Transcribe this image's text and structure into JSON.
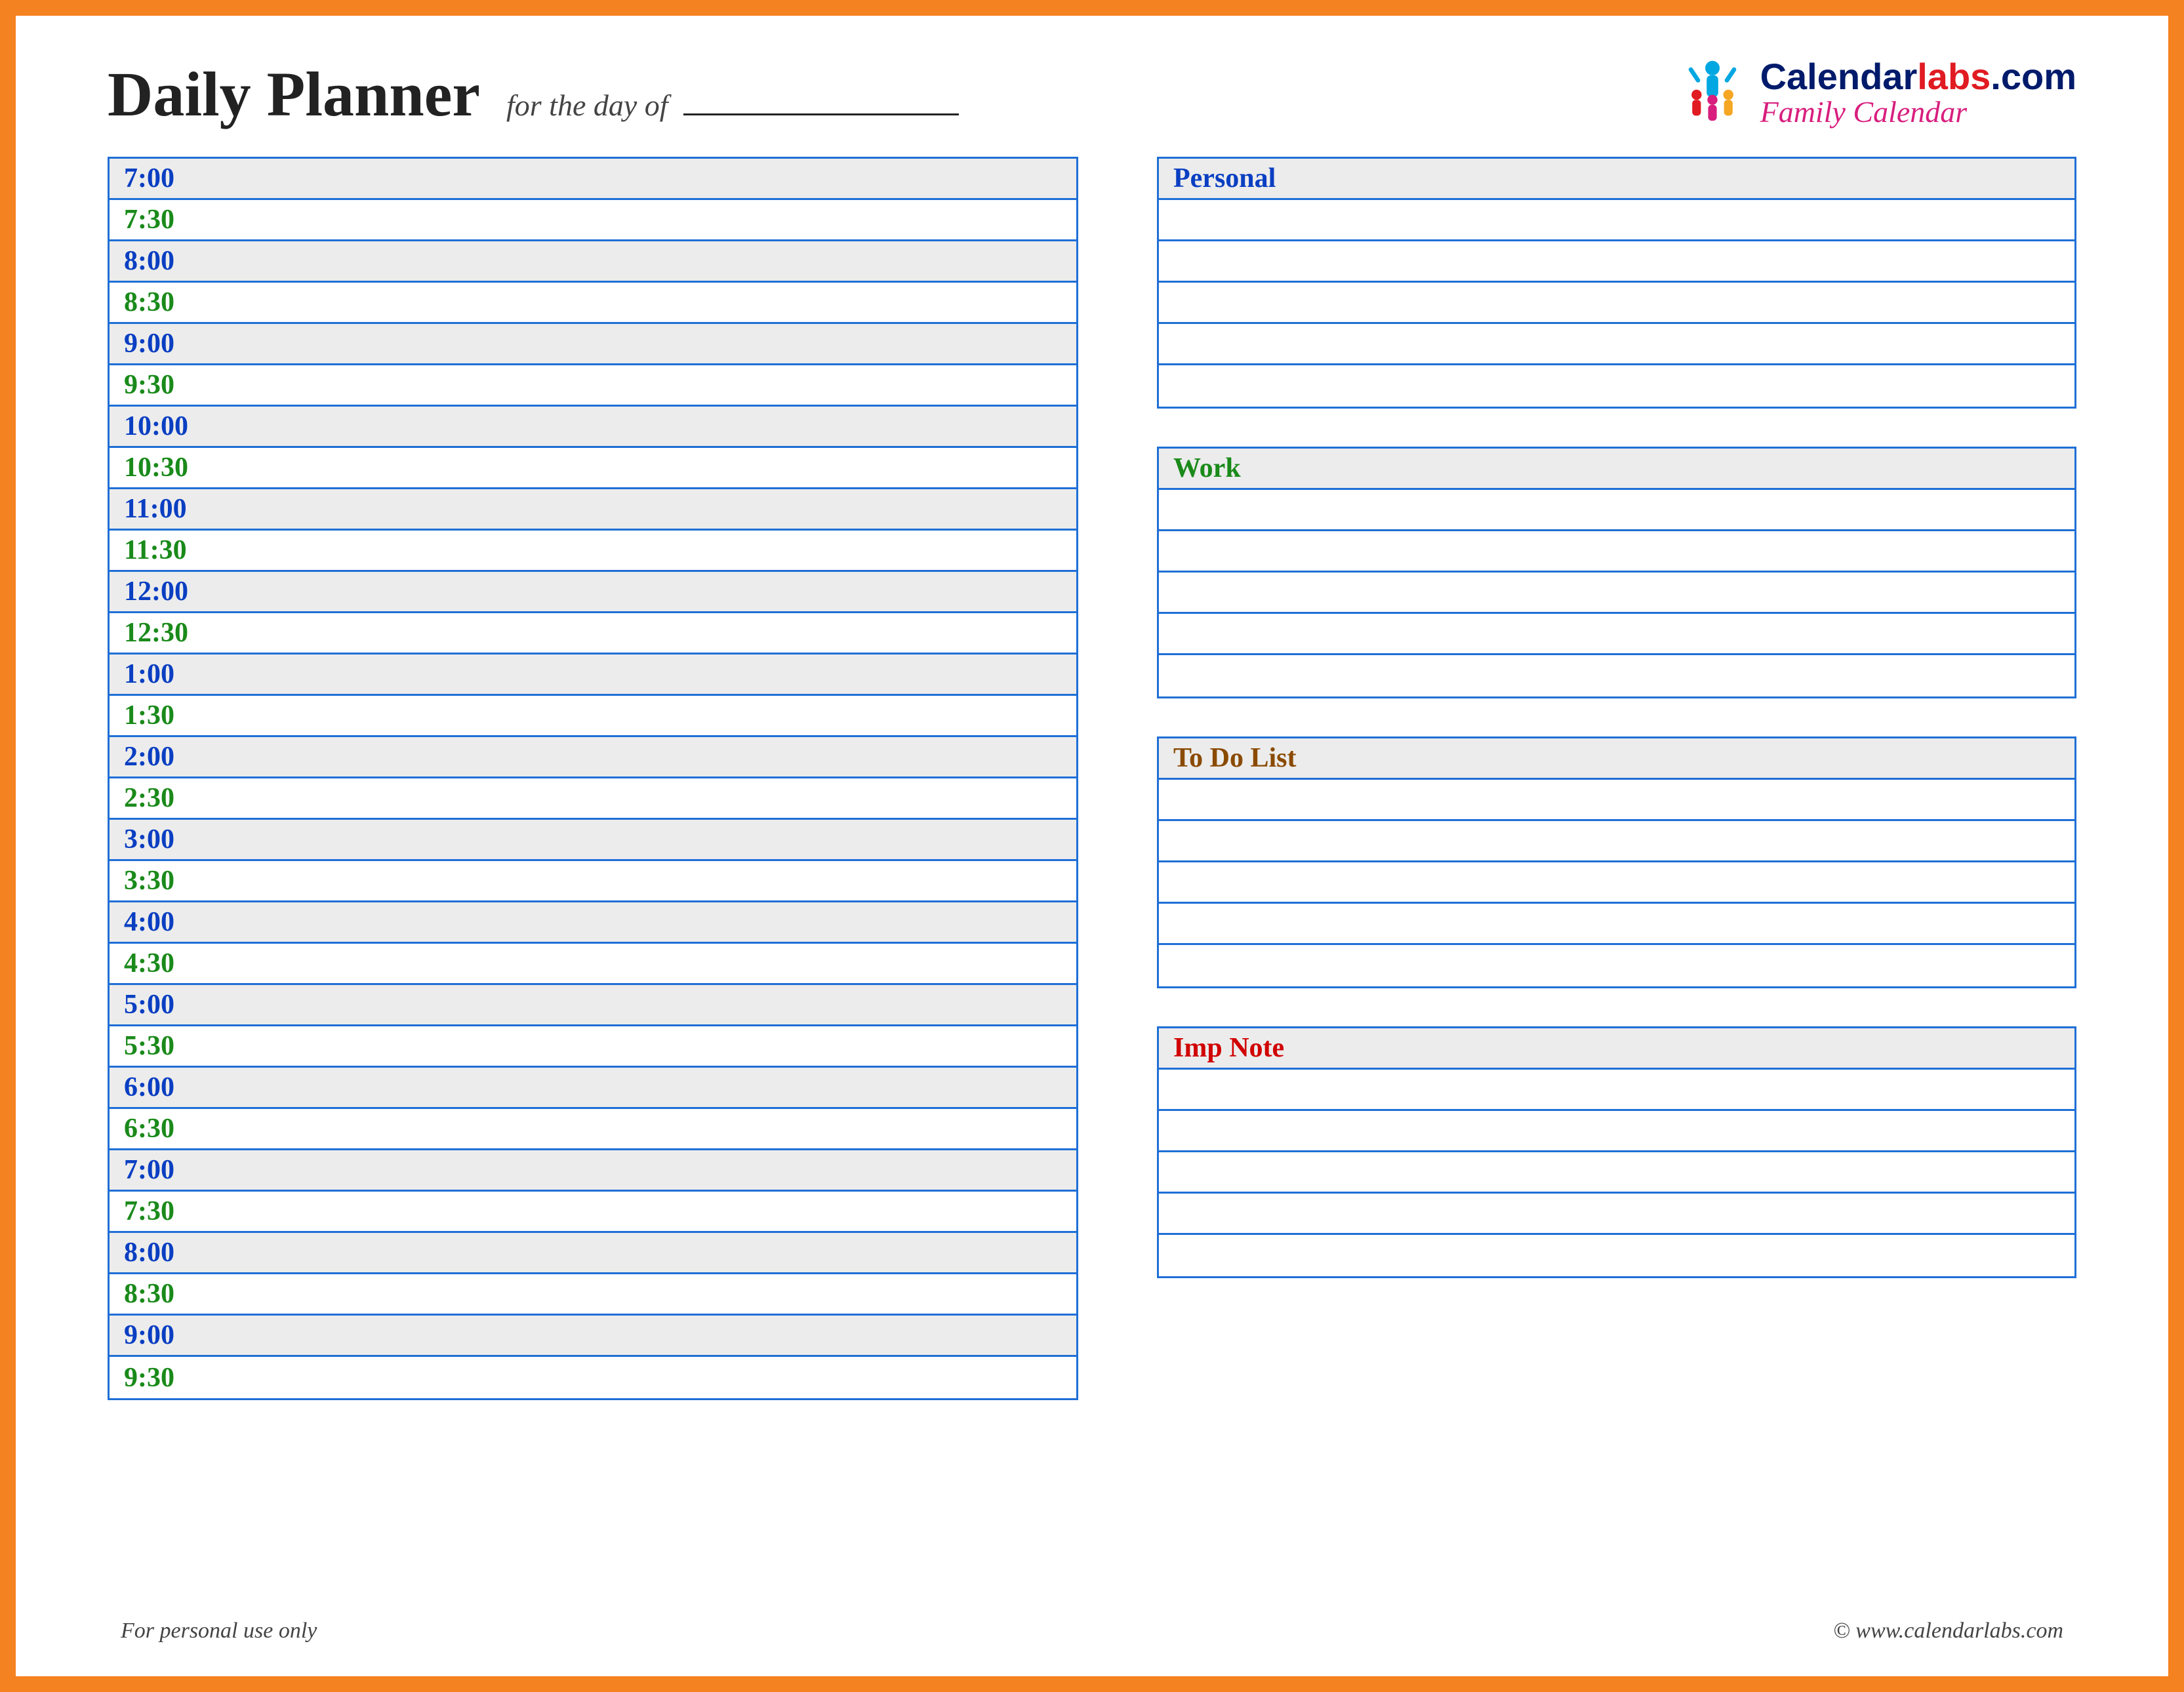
{
  "title": "Daily Planner",
  "subtitle": "for the day of",
  "logo": {
    "top_a": "Calendar",
    "top_b": "labs",
    "top_c": ".com",
    "bottom": "Family Calendar"
  },
  "times": [
    {
      "label": "7:00",
      "clr": "blue"
    },
    {
      "label": "7:30",
      "clr": "green"
    },
    {
      "label": "8:00",
      "clr": "blue"
    },
    {
      "label": "8:30",
      "clr": "green"
    },
    {
      "label": "9:00",
      "clr": "blue"
    },
    {
      "label": "9:30",
      "clr": "green"
    },
    {
      "label": "10:00",
      "clr": "blue"
    },
    {
      "label": "10:30",
      "clr": "green"
    },
    {
      "label": "11:00",
      "clr": "blue"
    },
    {
      "label": "11:30",
      "clr": "green"
    },
    {
      "label": "12:00",
      "clr": "blue"
    },
    {
      "label": "12:30",
      "clr": "green"
    },
    {
      "label": "1:00",
      "clr": "blue"
    },
    {
      "label": "1:30",
      "clr": "green"
    },
    {
      "label": "2:00",
      "clr": "blue"
    },
    {
      "label": "2:30",
      "clr": "green"
    },
    {
      "label": "3:00",
      "clr": "blue"
    },
    {
      "label": "3:30",
      "clr": "green"
    },
    {
      "label": "4:00",
      "clr": "blue"
    },
    {
      "label": "4:30",
      "clr": "green"
    },
    {
      "label": "5:00",
      "clr": "blue"
    },
    {
      "label": "5:30",
      "clr": "green"
    },
    {
      "label": "6:00",
      "clr": "blue"
    },
    {
      "label": "6:30",
      "clr": "green"
    },
    {
      "label": "7:00",
      "clr": "blue"
    },
    {
      "label": "7:30",
      "clr": "green"
    },
    {
      "label": "8:00",
      "clr": "blue"
    },
    {
      "label": "8:30",
      "clr": "green"
    },
    {
      "label": "9:00",
      "clr": "blue"
    },
    {
      "label": "9:30",
      "clr": "green"
    }
  ],
  "sections": [
    {
      "name": "Personal",
      "clr": "blue",
      "rows": 5
    },
    {
      "name": "Work",
      "clr": "green",
      "rows": 5
    },
    {
      "name": "To Do List",
      "clr": "brown",
      "rows": 5
    },
    {
      "name": "Imp Note",
      "clr": "red",
      "rows": 5
    }
  ],
  "footer_left": "For personal use only",
  "footer_right": "© www.calendarlabs.com"
}
